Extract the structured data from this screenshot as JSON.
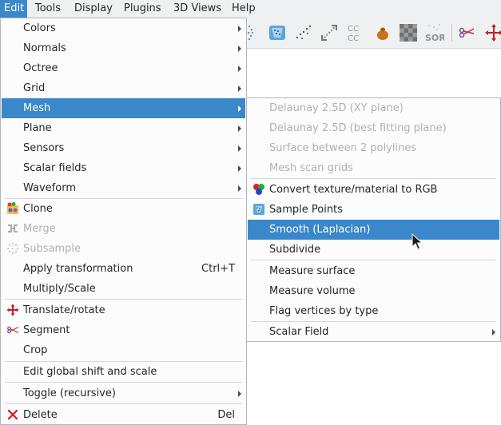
{
  "menubar": {
    "items": [
      {
        "label": "Edit"
      },
      {
        "label": "Tools"
      },
      {
        "label": "Display"
      },
      {
        "label": "Plugins"
      },
      {
        "label": "3D Views"
      },
      {
        "label": "Help"
      }
    ]
  },
  "edit_menu": {
    "colors": "Colors",
    "normals": "Normals",
    "octree": "Octree",
    "grid": "Grid",
    "mesh": "Mesh",
    "plane": "Plane",
    "sensors": "Sensors",
    "scalar_fields": "Scalar fields",
    "waveform": "Waveform",
    "clone": "Clone",
    "merge": "Merge",
    "subsample": "Subsample",
    "apply_transformation": "Apply transformation",
    "apply_transformation_shortcut": "Ctrl+T",
    "multiply_scale": "Multiply/Scale",
    "translate_rotate": "Translate/rotate",
    "segment": "Segment",
    "crop": "Crop",
    "edit_global_shift": "Edit global shift and scale",
    "toggle_recursive": "Toggle (recursive)",
    "delete": "Delete",
    "delete_shortcut": "Del"
  },
  "mesh_menu": {
    "delaunay_xy": "Delaunay 2.5D (XY plane)",
    "delaunay_best": "Delaunay 2.5D (best fitting plane)",
    "surface_between": "Surface between 2 polylines",
    "mesh_scan_grids": "Mesh scan grids",
    "convert_texture": "Convert texture/material to RGB",
    "sample_points": "Sample Points",
    "smooth_laplacian": "Smooth (Laplacian)",
    "subdivide": "Subdivide",
    "measure_surface": "Measure surface",
    "measure_volume": "Measure volume",
    "flag_vertices": "Flag vertices by type",
    "scalar_field": "Scalar Field"
  },
  "toolbar": {
    "icons": [
      "point-cloud-icon",
      "sample-points-icon",
      "subsample-icon",
      "distance-icon",
      "cc-compare-icon",
      "bag-icon",
      "checker-icon",
      "sor-icon",
      "segment-icon",
      "translate-rotate-icon"
    ],
    "cc_text": "CC\nCC",
    "sor_text": "SOR"
  },
  "colors": {
    "highlight": "#3a87c9",
    "menu_bg": "#fcfcfc",
    "disabled_text": "#aeb0b1",
    "text": "#232627"
  }
}
